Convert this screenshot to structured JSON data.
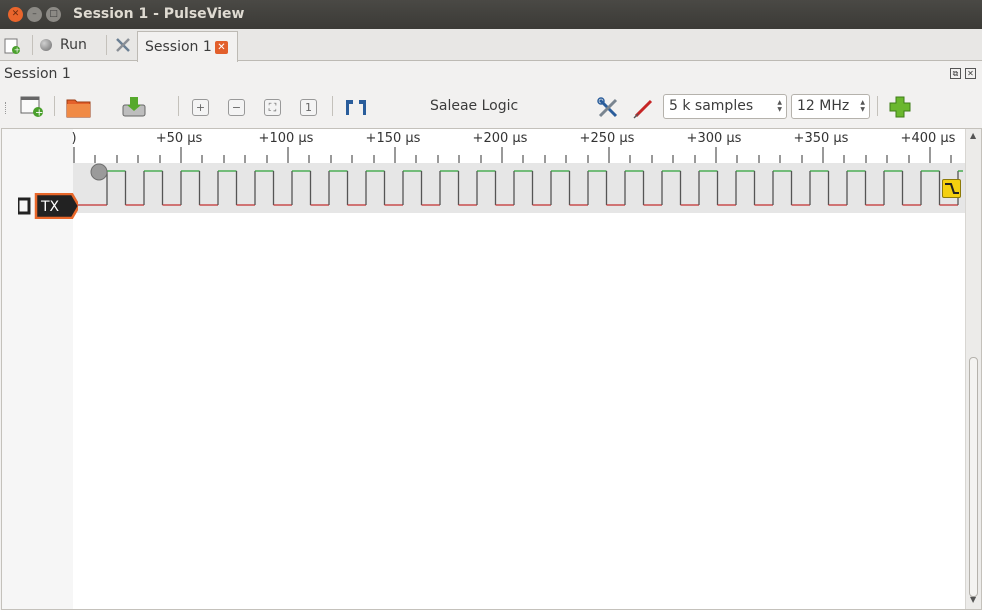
{
  "window": {
    "title": "Session 1 - PulseView"
  },
  "tabbar": {
    "run_label": "Run",
    "session_tab_label": "Session 1"
  },
  "session": {
    "header": "Session 1"
  },
  "toolbar": {
    "device": "Saleae Logic",
    "samples": "5 k samples",
    "samplerate": "12 MHz"
  },
  "ruler": {
    "ticks": [
      ")",
      "+50 µs",
      "+100 µs",
      "+150 µs",
      "+200 µs",
      "+250 µs",
      "+300 µs",
      "+350 µs",
      "+400 µs"
    ]
  },
  "channels": [
    {
      "name": "TX",
      "color": "#e8672a"
    }
  ],
  "colors": {
    "high": "#2fa33a",
    "low": "#c23131",
    "trace_bg": "#e6e6e6",
    "accent": "#e8672a"
  }
}
